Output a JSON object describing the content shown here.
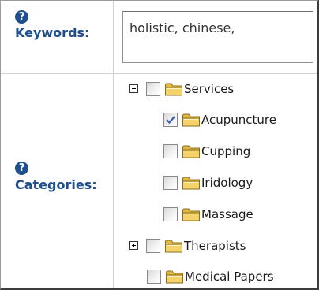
{
  "keywords": {
    "help_glyph": "?",
    "label": "Keywords:",
    "value": "holistic, chinese,"
  },
  "categories": {
    "help_glyph": "?",
    "label": "Categories:",
    "tree": [
      {
        "label": "Services",
        "checked": false,
        "expander": "collapse",
        "level": 0
      },
      {
        "label": "Acupuncture",
        "checked": true,
        "expander": null,
        "level": 1
      },
      {
        "label": "Cupping",
        "checked": false,
        "expander": null,
        "level": 1
      },
      {
        "label": "Iridology",
        "checked": false,
        "expander": null,
        "level": 1
      },
      {
        "label": "Massage",
        "checked": false,
        "expander": null,
        "level": 1
      },
      {
        "label": "Therapists",
        "checked": false,
        "expander": "expand",
        "level": 0
      },
      {
        "label": "Medical Papers",
        "checked": false,
        "expander": null,
        "level": 0
      }
    ]
  },
  "colors": {
    "label_blue": "#1f4f8c",
    "folder_yellow": "#f5d36a",
    "check_blue": "#3b5fb0"
  },
  "icons": {
    "help": "help-circle-icon",
    "folder": "folder-icon",
    "expand": "plus-box-icon",
    "collapse": "minus-box-icon",
    "check": "checkmark-icon"
  }
}
